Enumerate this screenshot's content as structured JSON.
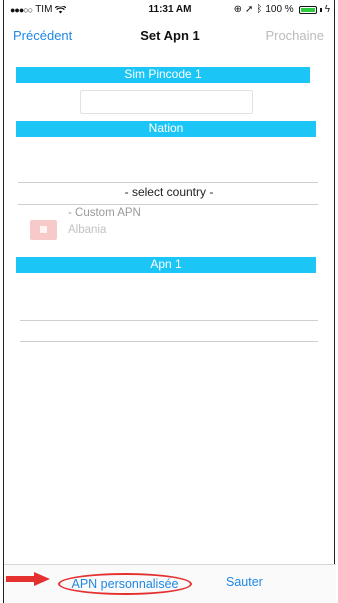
{
  "status_bar": {
    "carrier": "TIM",
    "time": "11:31 AM",
    "battery": "100 %",
    "battery_level": 100
  },
  "nav": {
    "back_label": "Précédent",
    "title": "Set Apn 1",
    "next_label": "Prochaine"
  },
  "sections": {
    "sim_pincode": "Sim Pincode 1",
    "nation": "Nation",
    "apn": "Apn 1"
  },
  "pin_input": {
    "value": "",
    "placeholder": ""
  },
  "country_select": {
    "selected": "- select country -"
  },
  "picker": {
    "items": [
      "- Custom APN",
      "Albania"
    ]
  },
  "bottom": {
    "custom_apn_label": "APN personnalisée",
    "skip_label": "Sauter"
  },
  "colors": {
    "accent": "#1bc6f6",
    "link": "#1e88e5",
    "annotation": "#e53030"
  }
}
